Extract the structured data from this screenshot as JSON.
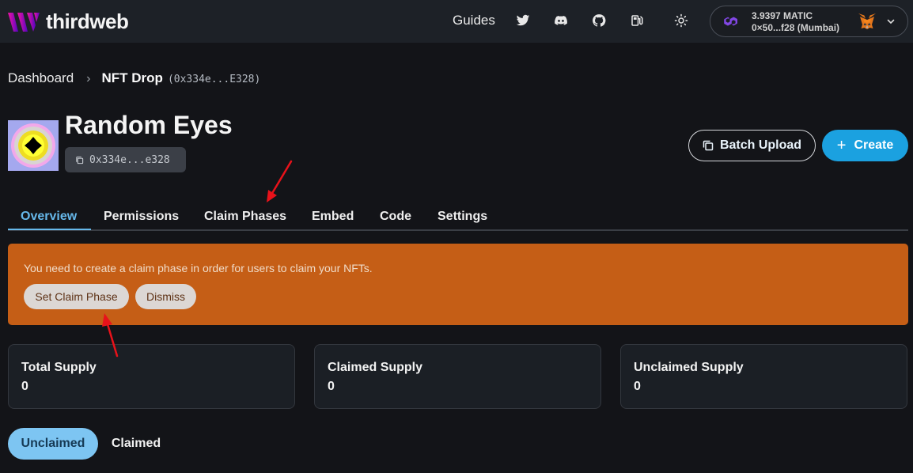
{
  "header": {
    "brand": "thirdweb",
    "nav_guides": "Guides",
    "icons": [
      "twitter-icon",
      "discord-icon",
      "github-icon",
      "gas-pump-icon",
      "sun-icon"
    ],
    "wallet": {
      "balance": "3.9397 MATIC",
      "address": "0×50...f28 (Mumbai)",
      "network_icon": "polygon-icon",
      "provider_icon": "metamask-fox-icon"
    }
  },
  "breadcrumb": {
    "root": "Dashboard",
    "current": "NFT Drop",
    "address": "(0x334e...E328)"
  },
  "contract": {
    "name": "Random Eyes",
    "address_short": "0x334e...e328"
  },
  "actions": {
    "batch_upload": "Batch Upload",
    "create": "Create"
  },
  "tabs": [
    {
      "label": "Overview",
      "active": true
    },
    {
      "label": "Permissions",
      "active": false
    },
    {
      "label": "Claim Phases",
      "active": false
    },
    {
      "label": "Embed",
      "active": false
    },
    {
      "label": "Code",
      "active": false
    },
    {
      "label": "Settings",
      "active": false
    }
  ],
  "alert": {
    "message": "You need to create a claim phase in order for users to claim your NFTs.",
    "primary": "Set Claim Phase",
    "secondary": "Dismiss"
  },
  "stats": [
    {
      "label": "Total Supply",
      "value": "0"
    },
    {
      "label": "Claimed Supply",
      "value": "0"
    },
    {
      "label": "Unclaimed Supply",
      "value": "0"
    }
  ],
  "filter": {
    "unclaimed": "Unclaimed",
    "claimed": "Claimed"
  },
  "colors": {
    "accent": "#1ba1e0",
    "tab_active": "#66b8ea",
    "alert_bg": "#c55e16",
    "annotation_arrow": "#e8121a"
  }
}
